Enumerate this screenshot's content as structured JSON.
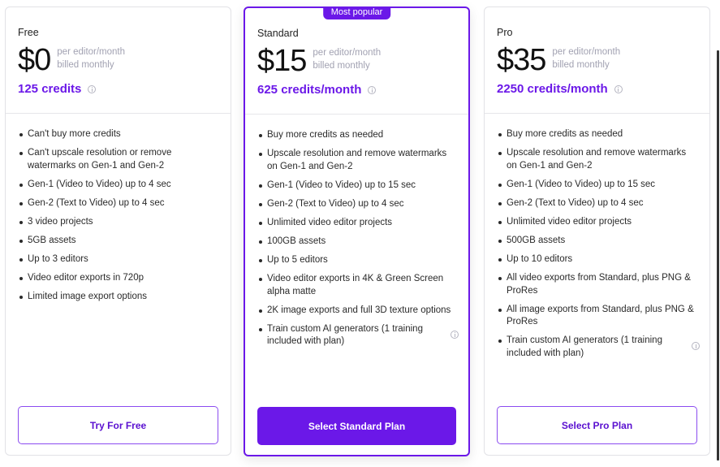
{
  "plans": [
    {
      "name": "Free",
      "price": "$0",
      "price_meta_1": "per editor/month",
      "price_meta_2": "billed monthly",
      "credits": "125 credits",
      "features": [
        "Can't buy more credits",
        "Can't upscale resolution or remove watermarks on Gen-1 and Gen-2",
        "Gen-1 (Video to Video) up to 4 sec",
        "Gen-2 (Text to Video) up to 4 sec",
        "3 video projects",
        "5GB assets",
        "Up to 3 editors",
        "Video editor exports in 720p",
        "Limited image export options"
      ],
      "cta": "Try For Free"
    },
    {
      "name": "Standard",
      "badge": "Most popular",
      "price": "$15",
      "price_meta_1": "per editor/month",
      "price_meta_2": "billed monthly",
      "credits": "625 credits/month",
      "features": [
        "Buy more credits as needed",
        "Upscale resolution and remove watermarks on Gen-1 and Gen-2",
        "Gen-1 (Video to Video) up to 15 sec",
        "Gen-2 (Text to Video) up to 4 sec",
        "Unlimited video editor projects",
        "100GB assets",
        "Up to 5 editors",
        "Video editor exports in 4K & Green Screen alpha matte",
        "2K image exports and full 3D texture options",
        "Train custom AI generators (1 training included with plan)"
      ],
      "cta": "Select Standard Plan"
    },
    {
      "name": "Pro",
      "price": "$35",
      "price_meta_1": "per editor/month",
      "price_meta_2": "billed monthly",
      "credits": "2250 credits/month",
      "features": [
        "Buy more credits as needed",
        "Upscale resolution and remove watermarks on Gen-1 and Gen-2",
        "Gen-1 (Video to Video) up to 15 sec",
        "Gen-2 (Text to Video) up to 4 sec",
        "Unlimited video editor projects",
        "500GB assets",
        "Up to 10 editors",
        "All video exports from Standard, plus PNG & ProRes",
        "All image exports from Standard, plus PNG & ProRes",
        "Train custom AI generators (1 training included with plan)"
      ],
      "cta": "Select Pro Plan"
    }
  ],
  "colors": {
    "accent": "#6b18e8",
    "muted_text": "#a2a2b2",
    "border": "#e2e2e6"
  },
  "icons": {
    "info": "info-circle-icon"
  }
}
